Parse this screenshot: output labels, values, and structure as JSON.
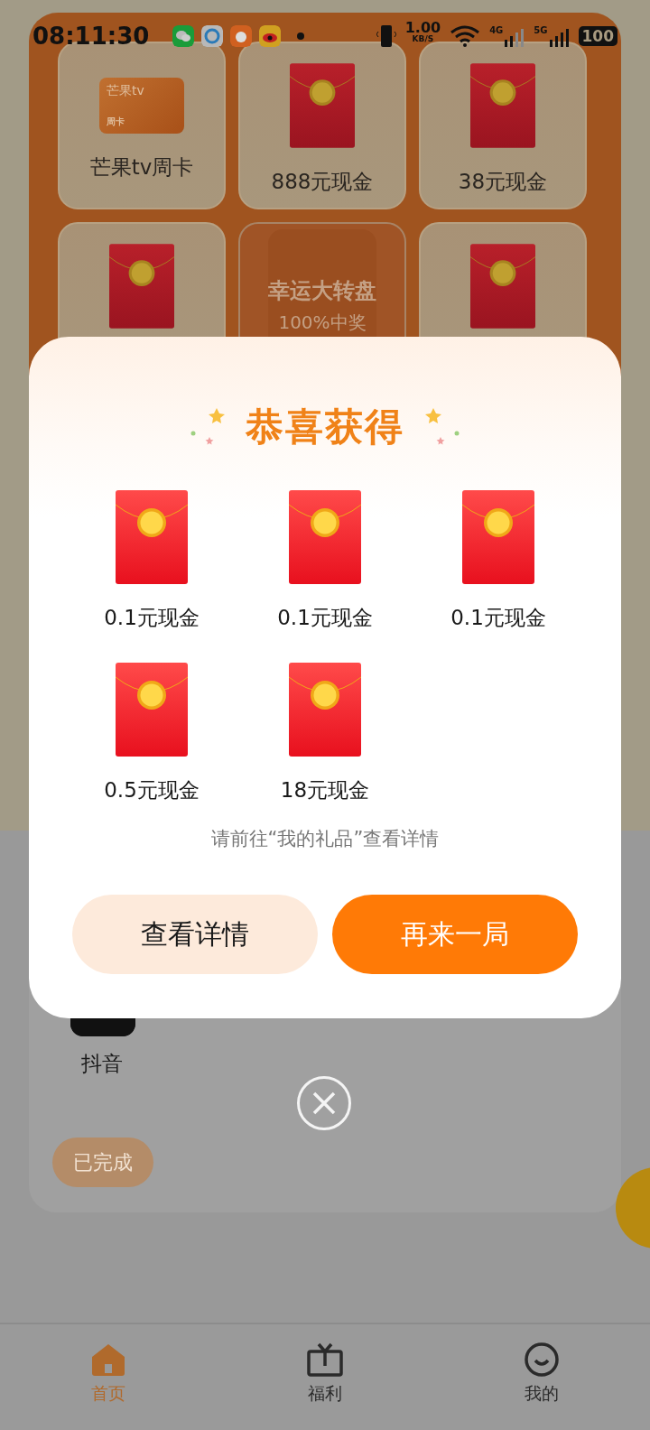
{
  "status_bar": {
    "time": "08:11:30",
    "network_speed": "1.00",
    "speed_unit": "KB/S",
    "signal_1": "4G",
    "signal_2": "5G",
    "battery": "100"
  },
  "prize_grid": [
    {
      "kind": "card",
      "label": "芒果tv周卡",
      "card_brand": "芒果tv",
      "card_type": "周卡"
    },
    {
      "kind": "envelope",
      "label": "888元现金"
    },
    {
      "kind": "envelope",
      "label": "38元现金"
    },
    {
      "kind": "envelope"
    },
    {
      "kind": "spin",
      "title": "幸运大转盘",
      "subtitle": "100%中奖"
    },
    {
      "kind": "envelope"
    }
  ],
  "task_card": {
    "app_name": "抖音",
    "button": "已完成"
  },
  "dialog": {
    "title": "恭喜获得",
    "prizes": [
      {
        "label": "0.1元现金"
      },
      {
        "label": "0.1元现金"
      },
      {
        "label": "0.1元现金"
      },
      {
        "label": "0.5元现金"
      },
      {
        "label": "18元现金"
      }
    ],
    "hint": "请前往“我的礼品”查看详情",
    "buttons": [
      {
        "label": "查看详情",
        "kind": "secondary"
      },
      {
        "label": "再来一局",
        "kind": "primary"
      }
    ]
  },
  "nav": [
    {
      "label": "首页",
      "selected": true
    },
    {
      "label": "福利",
      "selected": false
    },
    {
      "label": "我的",
      "selected": false
    }
  ]
}
